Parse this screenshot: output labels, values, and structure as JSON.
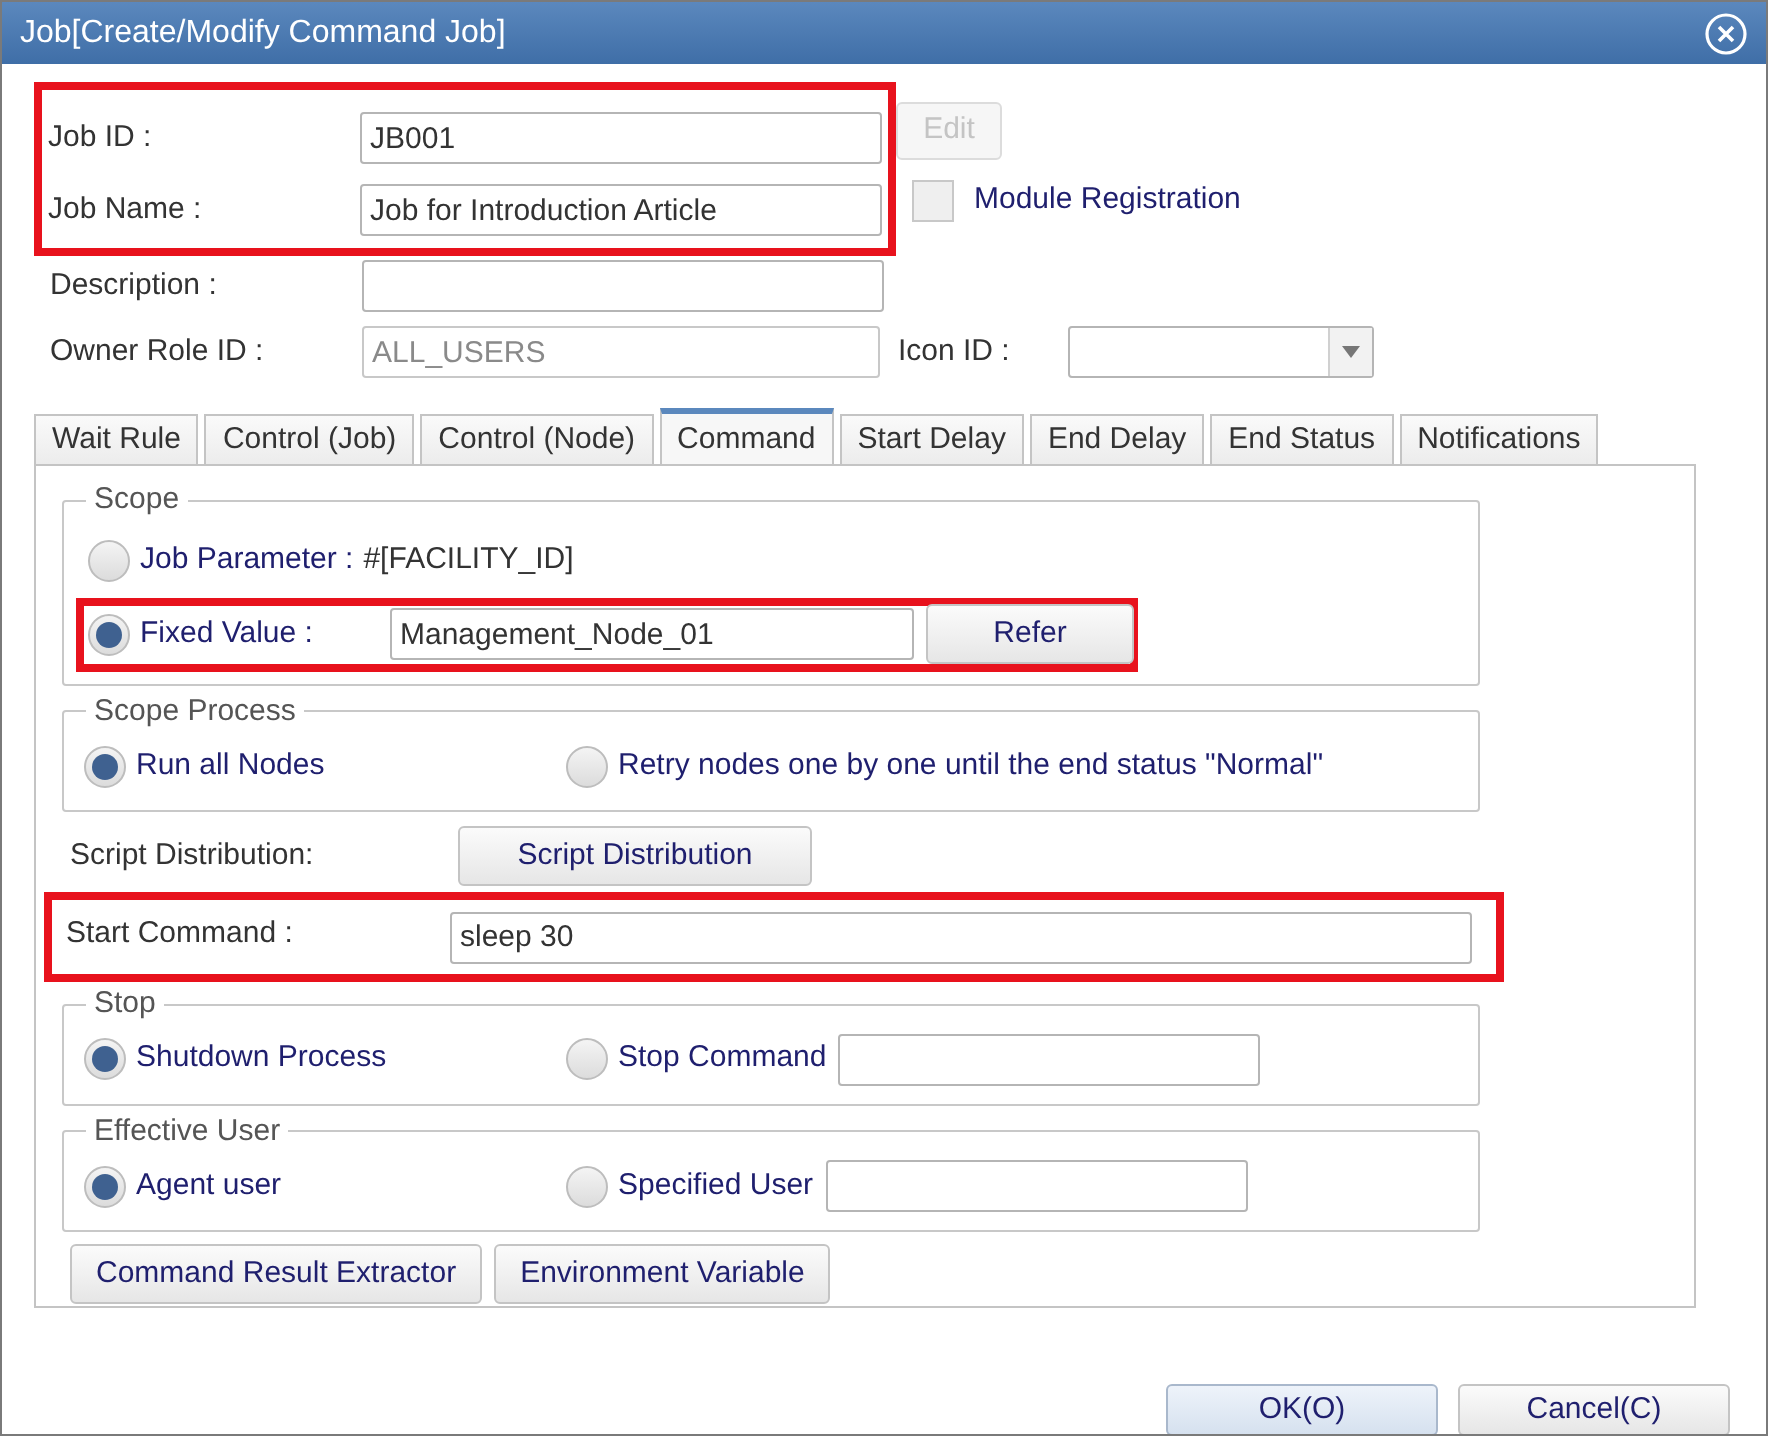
{
  "window": {
    "title": "Job[Create/Modify Command Job]"
  },
  "identity": {
    "highlighted": true,
    "fields": [
      {
        "label": "Job ID :",
        "value": "JB001"
      },
      {
        "label": "Job Name :",
        "value": "Job for Introduction Article"
      }
    ]
  },
  "edit_button": {
    "label": "Edit",
    "disabled": true
  },
  "module_registration": {
    "label": "Module Registration",
    "checked": false
  },
  "description": {
    "label": "Description :"
  },
  "owner_role": {
    "label": "Owner Role ID :",
    "value": "ALL_USERS",
    "disabled": true
  },
  "icon_id": {
    "label": "Icon ID :"
  },
  "tabs": [
    {
      "label": "Wait Rule",
      "selected": false
    },
    {
      "label": "Control (Job)",
      "selected": false
    },
    {
      "label": "Control (Node)",
      "selected": false
    },
    {
      "label": "Command",
      "selected": true
    },
    {
      "label": "Start Delay",
      "selected": false
    },
    {
      "label": "End Delay",
      "selected": false
    },
    {
      "label": "End Status",
      "selected": false
    },
    {
      "label": "Notifications",
      "selected": false
    }
  ],
  "scope": {
    "title": "Scope",
    "options": [
      {
        "kind": "text",
        "label": "Job Parameter :",
        "selected": false,
        "highlighted": false,
        "text": "#[FACILITY_ID]"
      },
      {
        "kind": "field",
        "label": "Fixed Value :",
        "selected": true,
        "highlighted": true,
        "value": "Management_Node_01",
        "button": "Refer"
      }
    ]
  },
  "scope_process": {
    "title": "Scope Process",
    "options": [
      {
        "label": "Run all Nodes",
        "selected": true,
        "has_field": false
      },
      {
        "label": "Retry nodes one by one until the end status \"Normal\"",
        "selected": false,
        "has_field": false
      }
    ]
  },
  "script_distribution": {
    "label": "Script Distribution:",
    "button": "Script Distribution"
  },
  "start_command": {
    "label": "Start Command :",
    "value": "sleep 30",
    "highlighted": true
  },
  "stop": {
    "title": "Stop",
    "options": [
      {
        "label": "Shutdown Process",
        "selected": true,
        "has_field": false
      },
      {
        "label": "Stop Command",
        "selected": false,
        "has_field": true
      }
    ]
  },
  "effective_user": {
    "title": "Effective User",
    "options": [
      {
        "label": "Agent user",
        "selected": true,
        "has_field": false
      },
      {
        "label": "Specified User",
        "selected": false,
        "has_field": true
      }
    ]
  },
  "panel_buttons": [
    "Command Result Extractor",
    "Environment Variable"
  ],
  "footer_buttons": [
    {
      "label": "OK(O)",
      "primary": true
    },
    {
      "label": "Cancel(C)",
      "primary": false
    }
  ]
}
